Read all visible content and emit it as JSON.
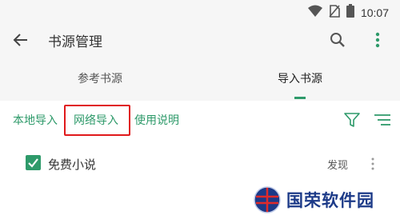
{
  "statusbar": {
    "time": "10:07",
    "icons": [
      "wifi-icon",
      "no-sim-icon",
      "battery-icon"
    ]
  },
  "toolbar": {
    "title": "书源管理",
    "back_icon": "arrow-left-icon",
    "search_icon": "search-icon",
    "more_icon": "vertical-dots-icon"
  },
  "tabs": [
    {
      "label": "参考书源",
      "active": false
    },
    {
      "label": "导入书源",
      "active": true
    }
  ],
  "import_options": {
    "local": "本地导入",
    "network": "网络导入",
    "help": "使用说明",
    "filter_icon": "filter-icon",
    "sort_icon": "sort-lines-icon"
  },
  "sources": [
    {
      "name": "免费小说",
      "checked": true,
      "action": "发现"
    }
  ],
  "watermark": {
    "text": "国荣软件园"
  },
  "colors": {
    "accent": "#2e9a6a",
    "highlight": "#e0191b",
    "bar_bg": "#f6f6f6"
  }
}
